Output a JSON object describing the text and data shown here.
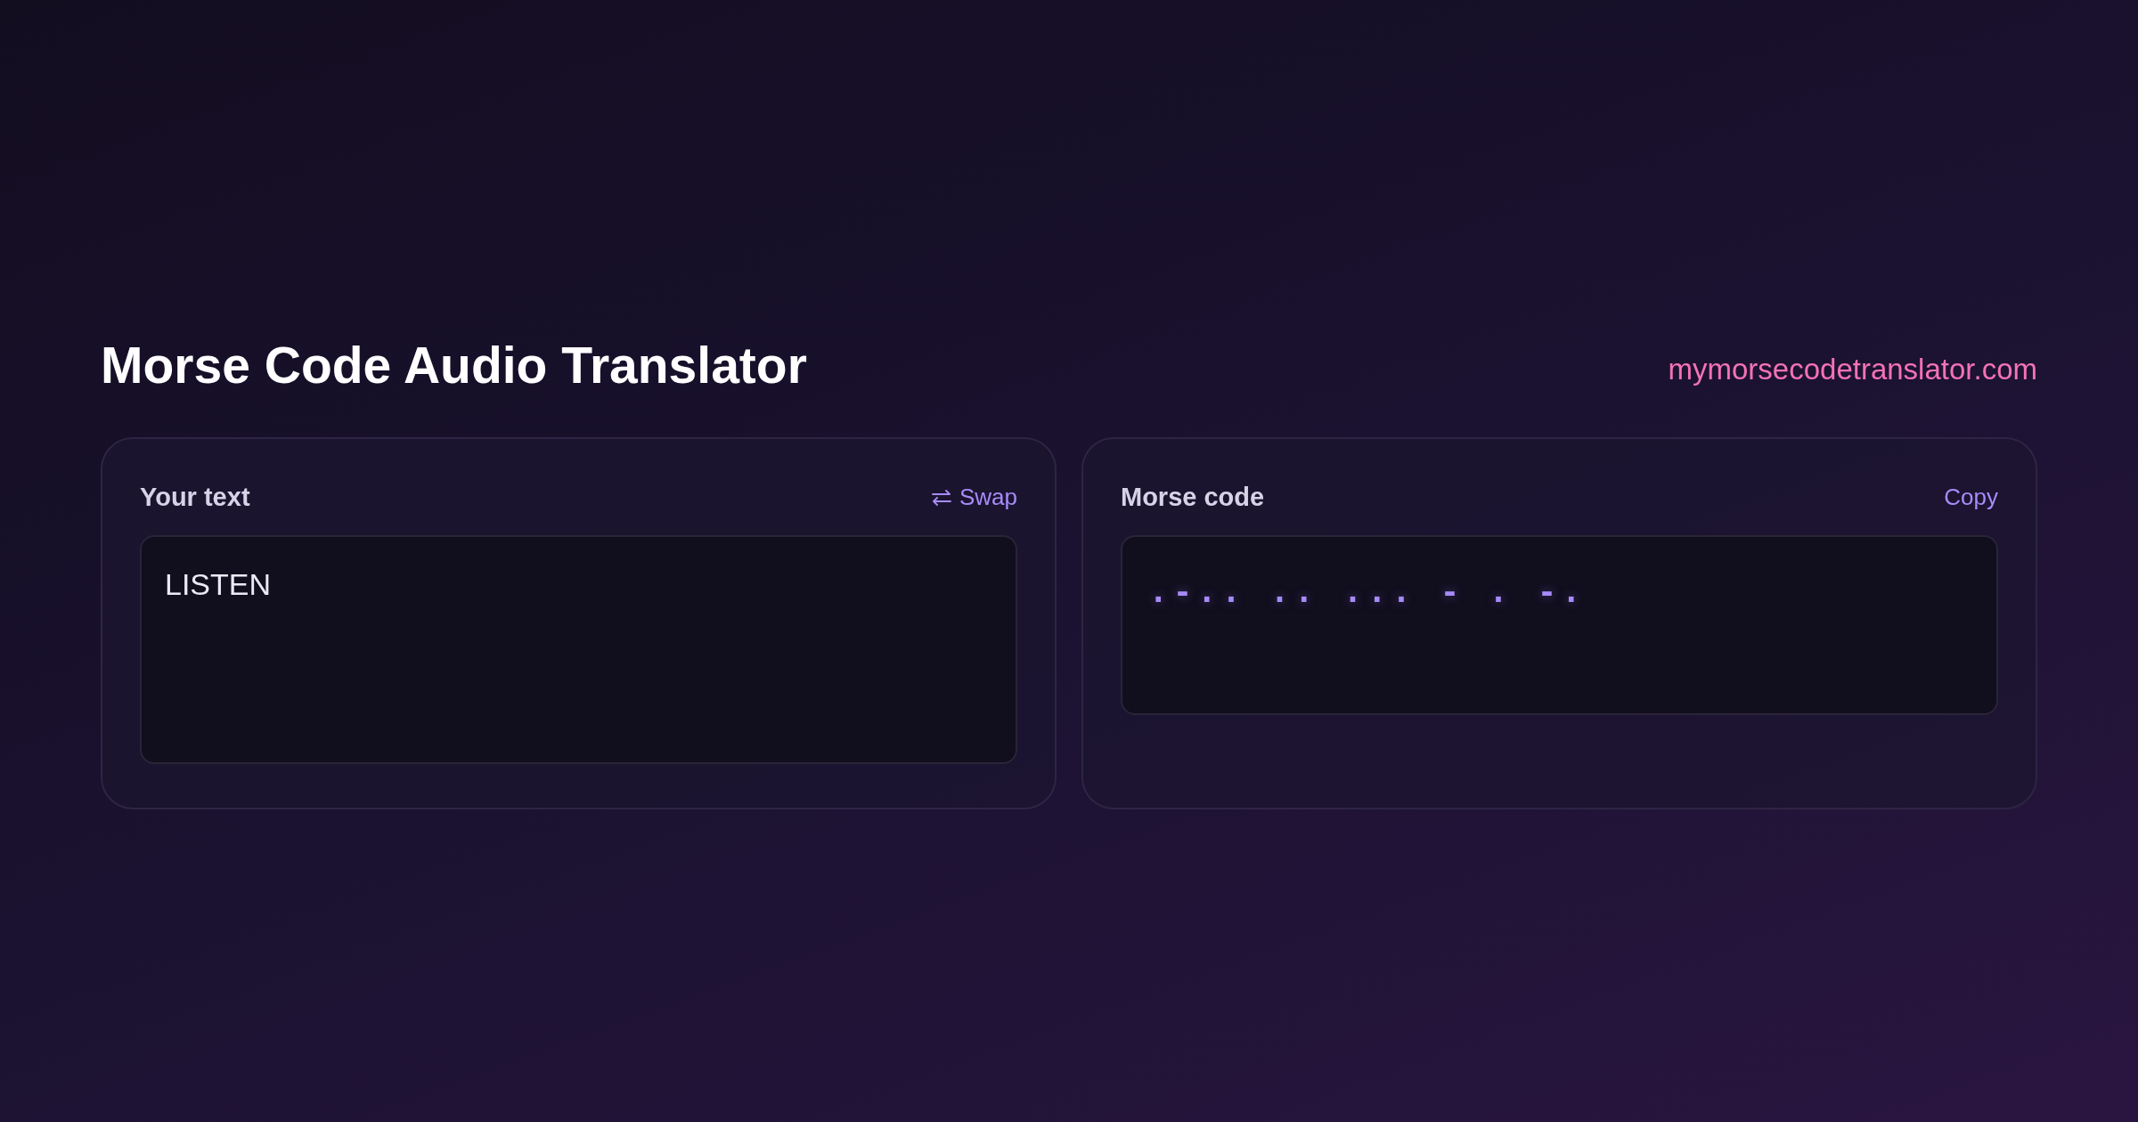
{
  "header": {
    "title": "Morse Code Audio Translator",
    "site": "mymorsecodetranslator.com"
  },
  "panels": [
    {
      "kind": "input",
      "label": "Your text",
      "action": {
        "label": "Swap",
        "icon": true
      },
      "value": "LISTEN"
    },
    {
      "kind": "output",
      "label": "Morse code",
      "action": {
        "label": "Copy",
        "icon": false
      },
      "value": ".-.. .. ... - . -."
    }
  ]
}
